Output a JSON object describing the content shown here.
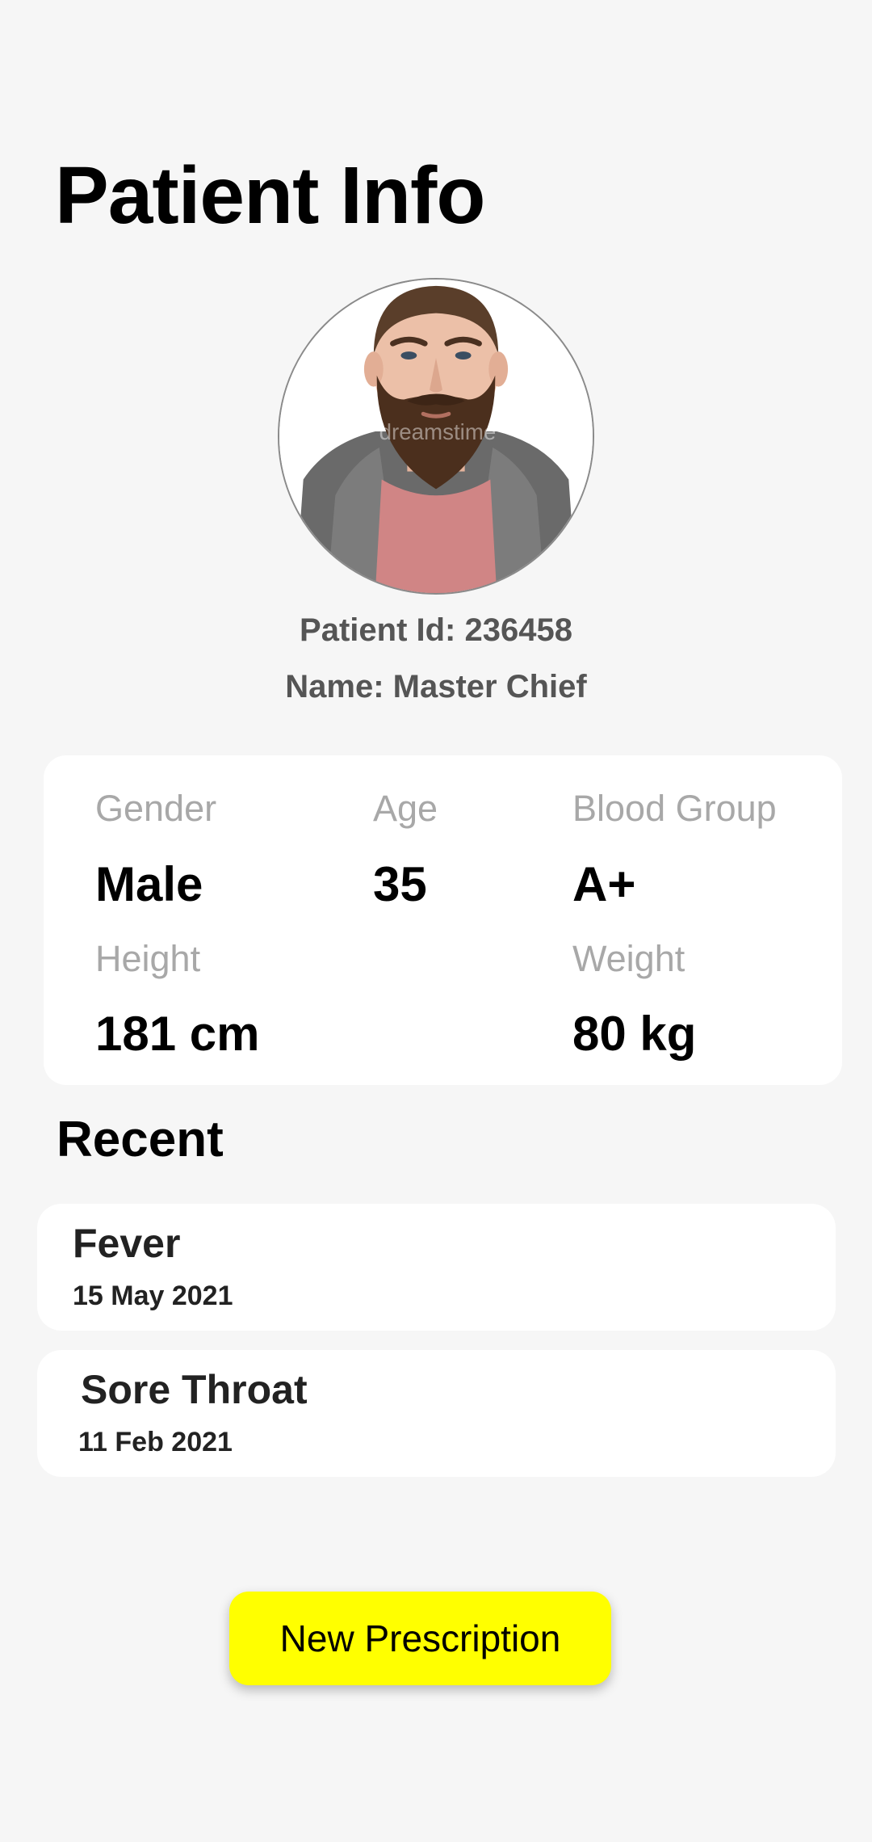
{
  "page": {
    "title": "Patient Info"
  },
  "patient": {
    "id_text": "Patient Id: 236458",
    "name_text": "Name: Master Chief",
    "avatar_watermark": "dreamstime"
  },
  "vitals": {
    "gender_label": "Gender",
    "gender_value": "Male",
    "age_label": "Age",
    "age_value": "35",
    "blood_group_label": "Blood Group",
    "blood_group_value": "A+",
    "height_label": "Height",
    "height_value": "181 cm",
    "weight_label": "Weight",
    "weight_value": "80 kg"
  },
  "recent": {
    "title": "Recent",
    "items": [
      {
        "title": "Fever",
        "date": "15 May 2021"
      },
      {
        "title": "Sore Throat",
        "date": "11 Feb 2021"
      }
    ]
  },
  "actions": {
    "new_prescription_label": "New Prescription"
  },
  "colors": {
    "background": "#f6f6f6",
    "card": "#ffffff",
    "accent_button": "#ffff00",
    "label_gray": "#a8a8a8",
    "subtext_gray": "#555555"
  }
}
